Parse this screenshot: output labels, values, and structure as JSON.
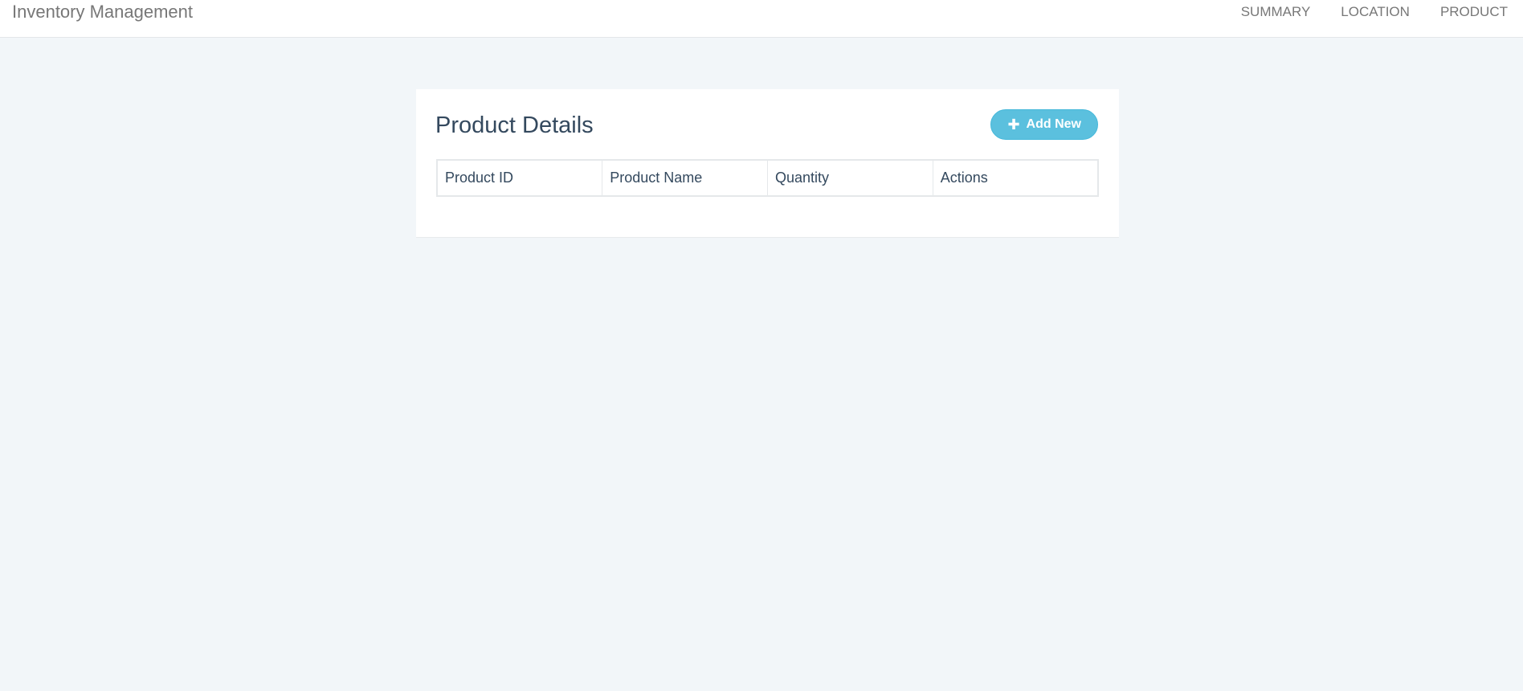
{
  "navbar": {
    "brand": "Inventory Management",
    "links": [
      "SUMMARY",
      "LOCATION",
      "PRODUCT"
    ]
  },
  "card": {
    "title": "Product Details",
    "add_button": {
      "icon": "plus-icon",
      "label": "Add New"
    },
    "table": {
      "columns": [
        "Product ID",
        "Product Name",
        "Quantity",
        "Actions"
      ],
      "rows": []
    }
  },
  "colors": {
    "background": "#f2f6f9",
    "title": "#34495e",
    "accent": "#5bc0de"
  }
}
